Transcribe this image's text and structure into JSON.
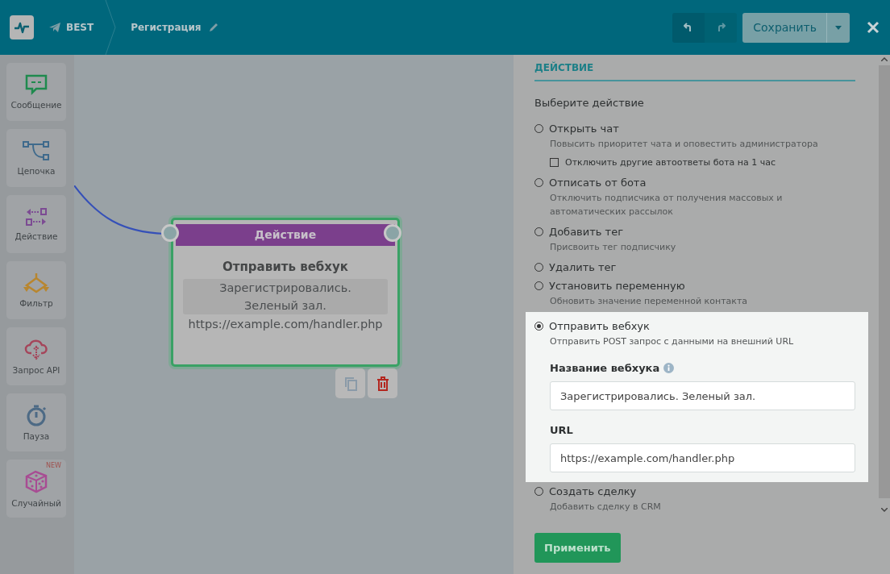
{
  "header": {
    "bot_name": "BEST",
    "flow_name": "Регистрация",
    "save_label": "Сохранить"
  },
  "sidebar": {
    "items": [
      {
        "kind": "message",
        "label": "Сообщение"
      },
      {
        "kind": "chain",
        "label": "Цепочка"
      },
      {
        "kind": "action",
        "label": "Действие"
      },
      {
        "kind": "filter",
        "label": "Фильтр"
      },
      {
        "kind": "api",
        "label": "Запрос API"
      },
      {
        "kind": "pause",
        "label": "Пауза"
      },
      {
        "kind": "random",
        "label": "Случайный",
        "badge": "NEW"
      }
    ]
  },
  "node": {
    "header": "Действие",
    "title": "Отправить вебхук",
    "name": "Зарегистрировались. Зеленый зал.",
    "url": "https://example.com/handler.php"
  },
  "panel": {
    "section": "ДЕЙСТВИЕ",
    "prompt": "Выберите действие",
    "apply_label": "Применить",
    "options": [
      {
        "label": "Открыть чат",
        "description": "Повысить приоритет чата и оповестить администратора",
        "selected": false,
        "checkbox": {
          "label": "Отключить другие автоответы бота на 1 час",
          "checked": false
        }
      },
      {
        "label": "Отписать от бота",
        "description": "Отключить подписчика от получения массовых и автоматических рассылок",
        "selected": false
      },
      {
        "label": "Добавить тег",
        "description": "Присвоить тег подписчику",
        "selected": false
      },
      {
        "label": "Удалить тег",
        "selected": false
      },
      {
        "label": "Установить переменную",
        "description": "Обновить значение переменной контакта",
        "selected": false
      },
      {
        "label": "Отправить вебхук",
        "description": "Отправить POST запрос с данными на внешний URL",
        "selected": true,
        "fields": [
          {
            "label": "Название вебхука",
            "info": true,
            "value": "Зарегистрировались. Зеленый зал."
          },
          {
            "label": "URL",
            "info": false,
            "value": "https://example.com/handler.php"
          }
        ]
      },
      {
        "label": "Создать сделку",
        "description": "Добавить сделку в CRM",
        "selected": false
      }
    ]
  }
}
